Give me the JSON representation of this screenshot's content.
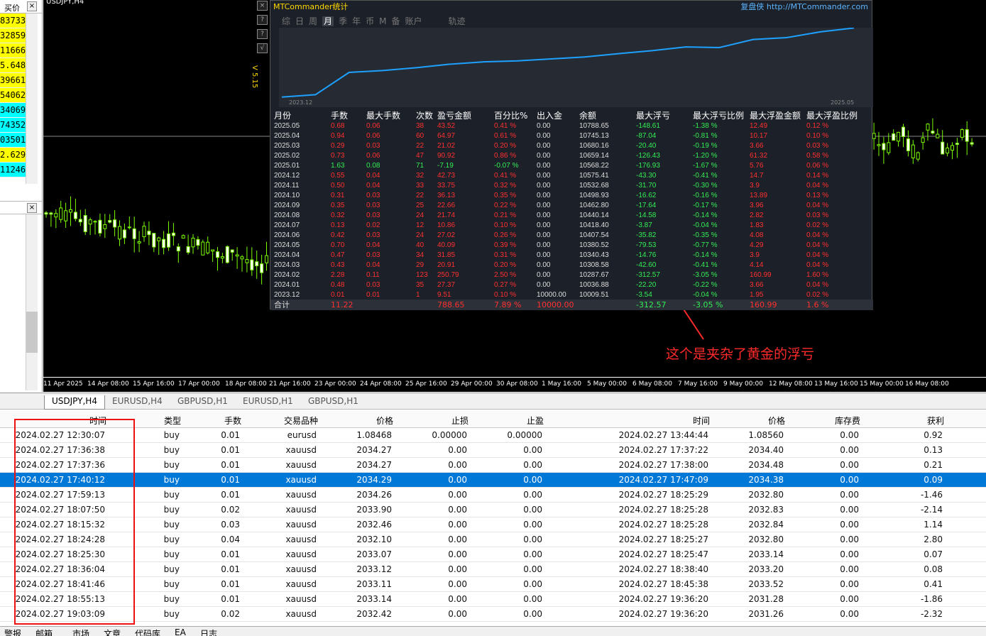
{
  "left_panel": {
    "header": "买价",
    "close": "×",
    "prices": [
      {
        "v": "83733",
        "c": "#ffff00"
      },
      {
        "v": "32859",
        "c": "#ffff00"
      },
      {
        "v": "11666",
        "c": "#ffff00"
      },
      {
        "v": "5.648",
        "c": "#ffff00"
      },
      {
        "v": "39661",
        "c": "#ffff00"
      },
      {
        "v": "54062",
        "c": "#ffff00"
      },
      {
        "v": "34069",
        "c": "#00ffff"
      },
      {
        "v": "74352",
        "c": "#00ffff"
      },
      {
        "v": "03501",
        "c": "#00ffff"
      },
      {
        "v": "2.629",
        "c": "#ffff00"
      },
      {
        "v": "11246",
        "c": "#00ffff"
      }
    ]
  },
  "chart": {
    "title": "USDJPY,H4",
    "annotation": "这个是夹杂了黄金的浮亏",
    "xlabels": [
      "11 Apr 2025",
      "14 Apr 08:00",
      "15 Apr 16:00",
      "17 Apr 00:00",
      "18 Apr 08:00",
      "21 Apr 16:00",
      "23 Apr 00:00",
      "24 Apr 08:00",
      "25 Apr 16:00",
      "29 Apr 00:00",
      "30 Apr 08:00",
      "1 May 16:00",
      "5 May 00:00",
      "6 May 08:00",
      "7 May 16:00",
      "9 May 00:00",
      "12 May 08:00",
      "13 May 16:00",
      "15 May 00:00",
      "16 May 08:00"
    ]
  },
  "panel": {
    "title": "MTCommander统计",
    "link": "复盘侠 http://MTCommander.com",
    "version": "V 5.15",
    "side_buttons": [
      "×",
      "?",
      "?",
      "√"
    ],
    "tabs": [
      "综",
      "日",
      "周",
      "月",
      "季",
      "年",
      "币",
      "M",
      "备",
      "账户",
      "轨迹"
    ],
    "active_tab": "月",
    "axis_start": "2023.12",
    "axis_end": "2025.05",
    "balance_series": [
      10009.51,
      10036.88,
      10287.67,
      10308.58,
      10340.43,
      10380.52,
      10407.54,
      10418.4,
      10440.14,
      10462.8,
      10498.93,
      10532.68,
      10575.41,
      10568.22,
      10659.14,
      10680.16,
      10745.13,
      10788.65
    ],
    "headers": [
      "月份",
      "手数",
      "最大手数",
      "次数",
      "盈亏金额",
      "百分比%",
      "出入金",
      "余额",
      "最大浮亏",
      "最大浮亏比例",
      "最大浮盈金额",
      "最大浮盈比例"
    ],
    "rows": [
      [
        "2025.05",
        "0.68",
        "0.06",
        "38",
        "43.52",
        "0.41 %",
        "0.00",
        "10788.65",
        "-148.61",
        "-1.38 %",
        "12.49",
        "0.12 %"
      ],
      [
        "2025.04",
        "0.94",
        "0.06",
        "60",
        "64.97",
        "0.61 %",
        "0.00",
        "10745.13",
        "-87.04",
        "-0.81 %",
        "10.17",
        "0.10 %"
      ],
      [
        "2025.03",
        "0.29",
        "0.03",
        "22",
        "21.02",
        "0.20 %",
        "0.00",
        "10680.16",
        "-20.40",
        "-0.19 %",
        "3.66",
        "0.03 %"
      ],
      [
        "2025.02",
        "0.73",
        "0.06",
        "47",
        "90.92",
        "0.86 %",
        "0.00",
        "10659.14",
        "-126.43",
        "-1.20 %",
        "61.32",
        "0.58 %"
      ],
      [
        "2025.01",
        "1.63",
        "0.08",
        "71",
        "-7.19",
        "-0.07 %",
        "0.00",
        "10568.22",
        "-176.93",
        "-1.67 %",
        "5.76",
        "0.06 %"
      ],
      [
        "2024.12",
        "0.55",
        "0.04",
        "32",
        "42.73",
        "0.41 %",
        "0.00",
        "10575.41",
        "-43.30",
        "-0.41 %",
        "14.7",
        "0.14 %"
      ],
      [
        "2024.11",
        "0.50",
        "0.04",
        "33",
        "33.75",
        "0.32 %",
        "0.00",
        "10532.68",
        "-31.70",
        "-0.30 %",
        "3.9",
        "0.04 %"
      ],
      [
        "2024.10",
        "0.31",
        "0.03",
        "22",
        "36.13",
        "0.35 %",
        "0.00",
        "10498.93",
        "-16.62",
        "-0.16 %",
        "13.89",
        "0.13 %"
      ],
      [
        "2024.09",
        "0.35",
        "0.03",
        "25",
        "22.66",
        "0.22 %",
        "0.00",
        "10462.80",
        "-17.64",
        "-0.17 %",
        "3.96",
        "0.04 %"
      ],
      [
        "2024.08",
        "0.32",
        "0.03",
        "24",
        "21.74",
        "0.21 %",
        "0.00",
        "10440.14",
        "-14.58",
        "-0.14 %",
        "2.82",
        "0.03 %"
      ],
      [
        "2024.07",
        "0.13",
        "0.02",
        "12",
        "10.86",
        "0.10 %",
        "0.00",
        "10418.40",
        "-3.87",
        "-0.04 %",
        "1.83",
        "0.02 %"
      ],
      [
        "2024.06",
        "0.42",
        "0.03",
        "24",
        "27.02",
        "0.26 %",
        "0.00",
        "10407.54",
        "-35.82",
        "-0.35 %",
        "4.08",
        "0.04 %"
      ],
      [
        "2024.05",
        "0.70",
        "0.04",
        "40",
        "40.09",
        "0.39 %",
        "0.00",
        "10380.52",
        "-79.53",
        "-0.77 %",
        "4.29",
        "0.04 %"
      ],
      [
        "2024.04",
        "0.47",
        "0.03",
        "34",
        "31.85",
        "0.31 %",
        "0.00",
        "10340.43",
        "-14.76",
        "-0.14 %",
        "3.9",
        "0.04 %"
      ],
      [
        "2024.03",
        "0.43",
        "0.04",
        "29",
        "20.91",
        "0.20 %",
        "0.00",
        "10308.58",
        "-42.60",
        "-0.41 %",
        "4.14",
        "0.04 %"
      ],
      [
        "2024.02",
        "2.28",
        "0.11",
        "123",
        "250.79",
        "2.50 %",
        "0.00",
        "10287.67",
        "-312.57",
        "-3.05 %",
        "160.99",
        "1.60 %"
      ],
      [
        "2024.01",
        "0.48",
        "0.03",
        "35",
        "27.37",
        "0.27 %",
        "0.00",
        "10036.88",
        "-22.20",
        "-0.22 %",
        "3.66",
        "0.04 %"
      ],
      [
        "2023.12",
        "0.01",
        "0.01",
        "1",
        "9.51",
        "0.10 %",
        "10000.00",
        "10009.51",
        "-3.54",
        "-0.04 %",
        "1.95",
        "0.02 %"
      ]
    ],
    "total": [
      "合计",
      "11.22",
      "",
      "",
      "788.65",
      "7.89 %",
      "10000.00",
      "",
      "-312.57",
      "-3.05 %",
      "160.99",
      "1.6 %"
    ]
  },
  "chart_tabs": [
    "USDJPY,H4",
    "EURUSD,H4",
    "GBPUSD,H1",
    "EURUSD,H1",
    "GBPUSD,H1"
  ],
  "active_chart_tab": "USDJPY,H4",
  "trades": {
    "headers": [
      "时间",
      "类型",
      "手数",
      "交易品种",
      "价格",
      "止损",
      "止盈",
      "时间",
      "价格",
      "库存费",
      "获利"
    ],
    "rows": [
      [
        "2024.02.27 12:30:07",
        "buy",
        "0.01",
        "eurusd",
        "1.08468",
        "0.00000",
        "0.00000",
        "2024.02.27 13:44:44",
        "1.08560",
        "0.00",
        "0.92"
      ],
      [
        "2024.02.27 17:36:38",
        "buy",
        "0.01",
        "xauusd",
        "2034.27",
        "0.00",
        "0.00",
        "2024.02.27 17:37:22",
        "2034.40",
        "0.00",
        "0.13"
      ],
      [
        "2024.02.27 17:37:36",
        "buy",
        "0.01",
        "xauusd",
        "2034.27",
        "0.00",
        "0.00",
        "2024.02.27 17:38:00",
        "2034.48",
        "0.00",
        "0.21"
      ],
      [
        "2024.02.27 17:40:12",
        "buy",
        "0.01",
        "xauusd",
        "2034.29",
        "0.00",
        "0.00",
        "2024.02.27 17:47:09",
        "2034.38",
        "0.00",
        "0.09"
      ],
      [
        "2024.02.27 17:59:13",
        "buy",
        "0.01",
        "xauusd",
        "2034.26",
        "0.00",
        "0.00",
        "2024.02.27 18:25:29",
        "2032.80",
        "0.00",
        "-1.46"
      ],
      [
        "2024.02.27 18:07:50",
        "buy",
        "0.02",
        "xauusd",
        "2033.90",
        "0.00",
        "0.00",
        "2024.02.27 18:25:28",
        "2032.83",
        "0.00",
        "-2.14"
      ],
      [
        "2024.02.27 18:15:32",
        "buy",
        "0.03",
        "xauusd",
        "2032.46",
        "0.00",
        "0.00",
        "2024.02.27 18:25:28",
        "2032.84",
        "0.00",
        "1.14"
      ],
      [
        "2024.02.27 18:24:28",
        "buy",
        "0.04",
        "xauusd",
        "2032.10",
        "0.00",
        "0.00",
        "2024.02.27 18:25:27",
        "2032.80",
        "0.00",
        "2.80"
      ],
      [
        "2024.02.27 18:25:30",
        "buy",
        "0.01",
        "xauusd",
        "2033.07",
        "0.00",
        "0.00",
        "2024.02.27 18:25:47",
        "2033.14",
        "0.00",
        "0.07"
      ],
      [
        "2024.02.27 18:36:04",
        "buy",
        "0.01",
        "xauusd",
        "2033.12",
        "0.00",
        "0.00",
        "2024.02.27 18:38:40",
        "2033.20",
        "0.00",
        "0.08"
      ],
      [
        "2024.02.27 18:41:46",
        "buy",
        "0.01",
        "xauusd",
        "2033.11",
        "0.00",
        "0.00",
        "2024.02.27 18:45:38",
        "2033.52",
        "0.00",
        "0.41"
      ],
      [
        "2024.02.27 18:55:13",
        "buy",
        "0.01",
        "xauusd",
        "2033.14",
        "0.00",
        "0.00",
        "2024.02.27 19:36:20",
        "2031.28",
        "0.00",
        "-1.86"
      ],
      [
        "2024.02.27 19:03:09",
        "buy",
        "0.02",
        "xauusd",
        "2032.42",
        "0.00",
        "0.00",
        "2024.02.27 19:36:20",
        "2031.26",
        "0.00",
        "-2.32"
      ]
    ],
    "selected_row": 3
  },
  "bottom_tabs": [
    "警报",
    "邮箱",
    "市场",
    "文章",
    "代码库",
    "EA",
    "日志"
  ]
}
